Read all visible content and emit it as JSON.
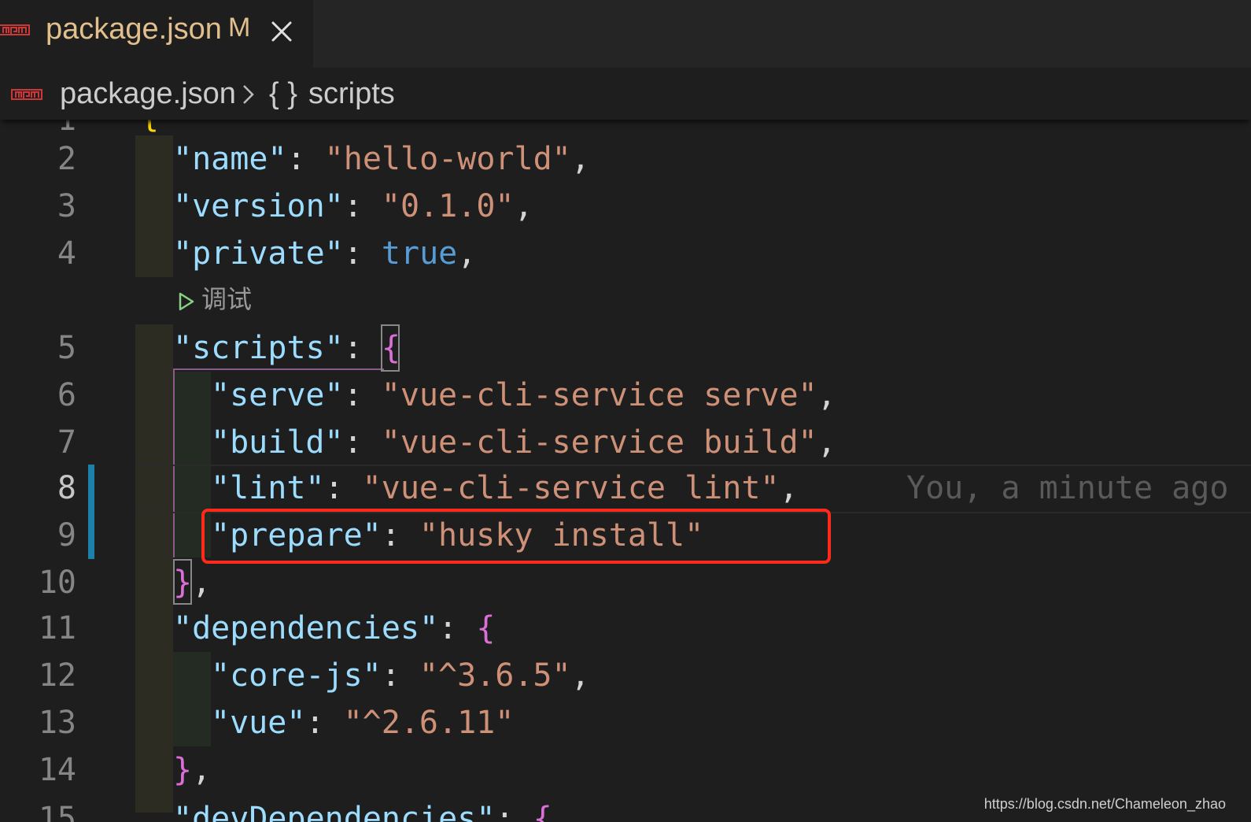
{
  "tab": {
    "title": "package.json",
    "status": "M",
    "icon": "npm-icon",
    "close_icon": "close-icon"
  },
  "breadcrumb": {
    "file": "package.json",
    "separator_icon": "chevron-right-icon",
    "symbol": "{ }",
    "section": "scripts"
  },
  "codelens": {
    "label": "调试",
    "icon": "play-icon"
  },
  "blame": {
    "text": "You, a minute ago"
  },
  "lines": [
    {
      "num": "2",
      "tokens": [
        {
          "t": "\"name\"",
          "c": "k"
        },
        {
          "t": ": ",
          "c": "p"
        },
        {
          "t": "\"hello-world\"",
          "c": "s"
        },
        {
          "t": ",",
          "c": "p"
        }
      ]
    },
    {
      "num": "3",
      "tokens": [
        {
          "t": "\"version\"",
          "c": "k"
        },
        {
          "t": ": ",
          "c": "p"
        },
        {
          "t": "\"0.1.0\"",
          "c": "s"
        },
        {
          "t": ",",
          "c": "p"
        }
      ]
    },
    {
      "num": "4",
      "tokens": [
        {
          "t": "\"private\"",
          "c": "k"
        },
        {
          "t": ": ",
          "c": "p"
        },
        {
          "t": "true",
          "c": "b"
        },
        {
          "t": ",",
          "c": "p"
        }
      ]
    },
    {
      "num": "5",
      "tokens": [
        {
          "t": "\"scripts\"",
          "c": "k"
        },
        {
          "t": ": ",
          "c": "p"
        },
        {
          "t": "{",
          "c": "br2"
        }
      ]
    },
    {
      "num": "6",
      "tokens": [
        {
          "t": "\"serve\"",
          "c": "k"
        },
        {
          "t": ": ",
          "c": "p"
        },
        {
          "t": "\"vue-cli-service serve\"",
          "c": "s"
        },
        {
          "t": ",",
          "c": "p"
        }
      ]
    },
    {
      "num": "7",
      "tokens": [
        {
          "t": "\"build\"",
          "c": "k"
        },
        {
          "t": ": ",
          "c": "p"
        },
        {
          "t": "\"vue-cli-service build\"",
          "c": "s"
        },
        {
          "t": ",",
          "c": "p"
        }
      ]
    },
    {
      "num": "8",
      "tokens": [
        {
          "t": "\"lint\"",
          "c": "k"
        },
        {
          "t": ": ",
          "c": "p"
        },
        {
          "t": "\"vue-cli-service lint\"",
          "c": "s"
        },
        {
          "t": ",",
          "c": "p"
        }
      ]
    },
    {
      "num": "9",
      "tokens": [
        {
          "t": "\"prepare\"",
          "c": "k"
        },
        {
          "t": ": ",
          "c": "p"
        },
        {
          "t": "\"husky install\"",
          "c": "s"
        }
      ]
    },
    {
      "num": "10",
      "tokens": [
        {
          "t": "}",
          "c": "br2"
        },
        {
          "t": ",",
          "c": "p"
        }
      ]
    },
    {
      "num": "11",
      "tokens": [
        {
          "t": "\"dependencies\"",
          "c": "k"
        },
        {
          "t": ": ",
          "c": "p"
        },
        {
          "t": "{",
          "c": "br2"
        }
      ]
    },
    {
      "num": "12",
      "tokens": [
        {
          "t": "\"core-js\"",
          "c": "k"
        },
        {
          "t": ": ",
          "c": "p"
        },
        {
          "t": "\"^3.6.5\"",
          "c": "s"
        },
        {
          "t": ",",
          "c": "p"
        }
      ]
    },
    {
      "num": "13",
      "tokens": [
        {
          "t": "\"vue\"",
          "c": "k"
        },
        {
          "t": ": ",
          "c": "p"
        },
        {
          "t": "\"^2.6.11\"",
          "c": "s"
        }
      ]
    },
    {
      "num": "14",
      "tokens": [
        {
          "t": "}",
          "c": "br2"
        },
        {
          "t": ",",
          "c": "p"
        }
      ]
    }
  ],
  "watermark": "https://blog.csdn.net/Chameleon_zhao"
}
